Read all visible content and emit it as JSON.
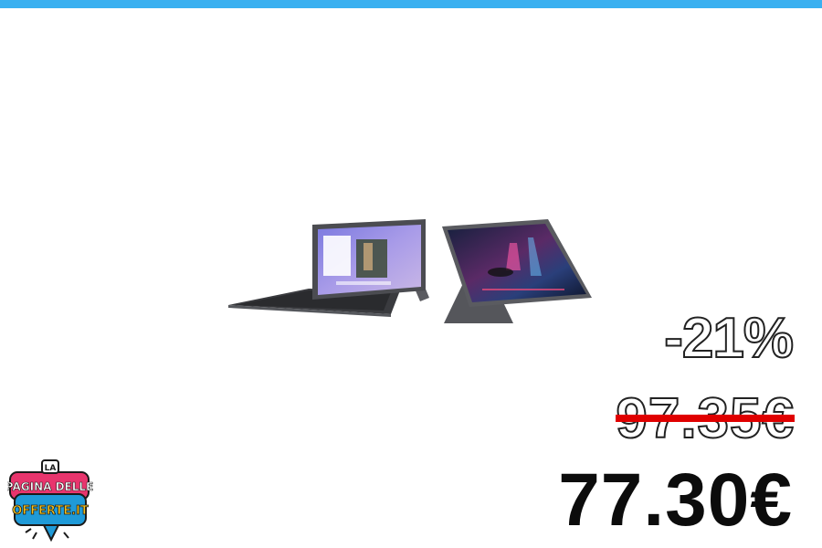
{
  "promo": {
    "discount": "-21%",
    "old_price": "97.35€",
    "new_price": "77.30€"
  },
  "logo": {
    "line1": "LA",
    "line2": "PAGINA DELLE",
    "line3": "OFFERTE.IT"
  },
  "colors": {
    "top_bar": "#3ab0f0",
    "strike": "#e00000",
    "logo_pink": "#e8356d",
    "logo_blue": "#1f9ad8",
    "logo_yellow": "#f7c21a"
  },
  "icons": {
    "product": "tablet-with-keyboard-image",
    "logo": "speech-bubble-logo"
  }
}
